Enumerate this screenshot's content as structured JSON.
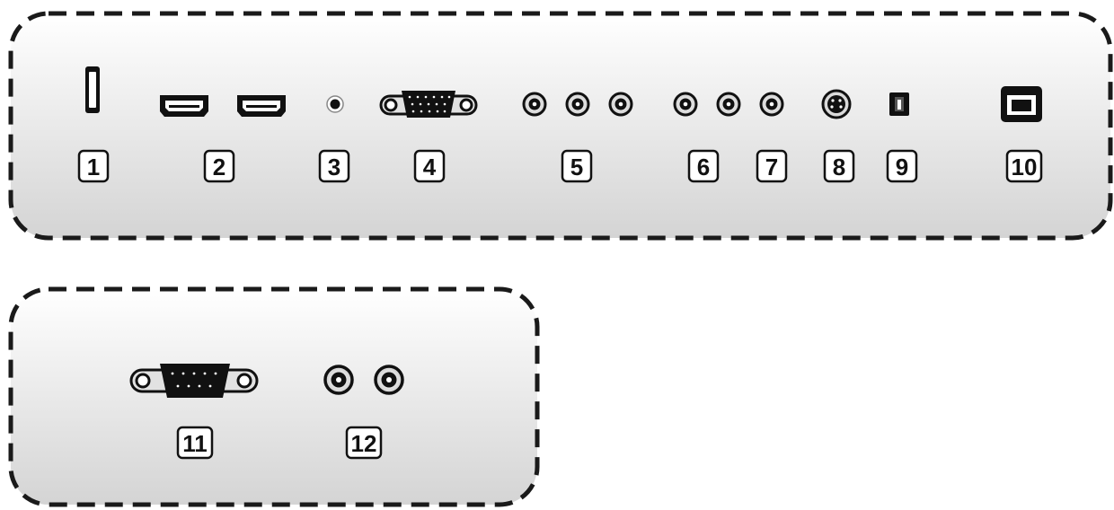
{
  "panels": [
    {
      "id": "main-panel",
      "connectors": [
        {
          "number": "1",
          "icon": "usb-a-port-icon"
        },
        {
          "number": "2",
          "icon": "hdmi-port-icon"
        },
        {
          "number": "3",
          "icon": "audio-jack-icon"
        },
        {
          "number": "4",
          "icon": "vga-port-icon"
        },
        {
          "number": "5",
          "icon": "component-rca-port-icon"
        },
        {
          "number": "6",
          "icon": "composite-rca-port-icon"
        },
        {
          "number": "7",
          "icon": "rca-audio-port-icon"
        },
        {
          "number": "8",
          "icon": "s-video-port-icon"
        },
        {
          "number": "9",
          "icon": "optical-audio-port-icon"
        },
        {
          "number": "10",
          "icon": "usb-b-port-icon"
        }
      ]
    },
    {
      "id": "secondary-panel",
      "connectors": [
        {
          "number": "11",
          "icon": "rs232-serial-port-icon"
        },
        {
          "number": "12",
          "icon": "rca-pair-port-icon"
        }
      ]
    }
  ],
  "colors": {
    "panel_gradient_top": "#ffffff",
    "panel_gradient_bottom": "#d6d6d6",
    "border": "#1a1a1a",
    "port": "#111111"
  }
}
